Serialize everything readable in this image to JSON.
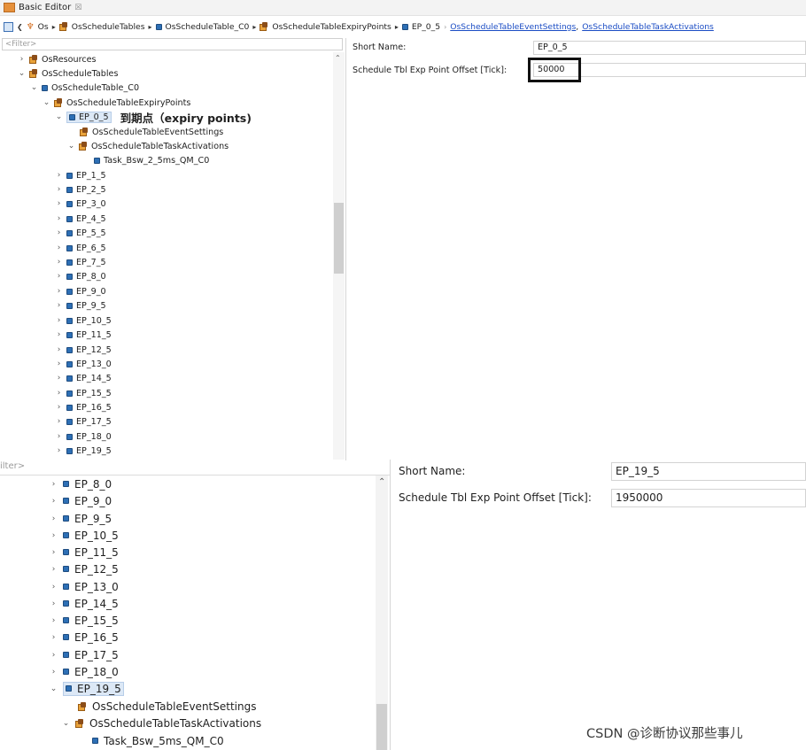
{
  "tab": {
    "title": "Basic Editor",
    "close": "☒"
  },
  "breadcrumb": {
    "items": [
      "Os",
      "OsScheduleTables",
      "OsScheduleTable_C0",
      "OsScheduleTableExpiryPoints",
      "EP_0_5"
    ],
    "links": [
      "OsScheduleTableEventSettings",
      "OsScheduleTableTaskActivations"
    ],
    "link_separator": ","
  },
  "top_tree": {
    "filter_placeholder": "<Filter>",
    "nodes": [
      {
        "label": "OsResources"
      },
      {
        "label": "OsScheduleTables"
      },
      {
        "label": "OsScheduleTable_C0"
      },
      {
        "label": "OsScheduleTableExpiryPoints"
      },
      {
        "label": "EP_0_5",
        "annotation": "到期点（expiry points)"
      },
      {
        "label": "OsScheduleTableEventSettings"
      },
      {
        "label": "OsScheduleTableTaskActivations"
      },
      {
        "label": "Task_Bsw_2_5ms_QM_C0"
      },
      {
        "label": "EP_1_5"
      },
      {
        "label": "EP_2_5"
      },
      {
        "label": "EP_3_0"
      },
      {
        "label": "EP_4_5"
      },
      {
        "label": "EP_5_5"
      },
      {
        "label": "EP_6_5"
      },
      {
        "label": "EP_7_5"
      },
      {
        "label": "EP_8_0"
      },
      {
        "label": "EP_9_0"
      },
      {
        "label": "EP_9_5"
      },
      {
        "label": "EP_10_5"
      },
      {
        "label": "EP_11_5"
      },
      {
        "label": "EP_12_5"
      },
      {
        "label": "EP_13_0"
      },
      {
        "label": "EP_14_5"
      },
      {
        "label": "EP_15_5"
      },
      {
        "label": "EP_16_5"
      },
      {
        "label": "EP_17_5"
      },
      {
        "label": "EP_18_0"
      },
      {
        "label": "EP_19_5"
      }
    ]
  },
  "top_form": {
    "short_name_label": "Short Name:",
    "short_name_value": "EP_0_5",
    "offset_label": "Schedule Tbl Exp Point Offset [Tick]:",
    "offset_value": "50000"
  },
  "bottom_tree": {
    "filter_placeholder": "ilter>",
    "nodes": [
      {
        "label": "EP_8_0"
      },
      {
        "label": "EP_9_0"
      },
      {
        "label": "EP_9_5"
      },
      {
        "label": "EP_10_5"
      },
      {
        "label": "EP_11_5"
      },
      {
        "label": "EP_12_5"
      },
      {
        "label": "EP_13_0"
      },
      {
        "label": "EP_14_5"
      },
      {
        "label": "EP_15_5"
      },
      {
        "label": "EP_16_5"
      },
      {
        "label": "EP_17_5"
      },
      {
        "label": "EP_18_0"
      },
      {
        "label": "EP_19_5"
      },
      {
        "label": "OsScheduleTableEventSettings"
      },
      {
        "label": "OsScheduleTableTaskActivations"
      },
      {
        "label": "Task_Bsw_5ms_QM_C0"
      }
    ]
  },
  "bottom_form": {
    "short_name_label": "Short Name:",
    "short_name_value": "EP_19_5",
    "offset_label": "Schedule Tbl Exp Point Offset [Tick]:",
    "offset_value": "1950000"
  },
  "watermark": "CSDN @诊断协议那些事儿",
  "colors": {
    "selection": "#dce8f6",
    "link": "#1a4cc4",
    "highlight_border": "#111111"
  }
}
